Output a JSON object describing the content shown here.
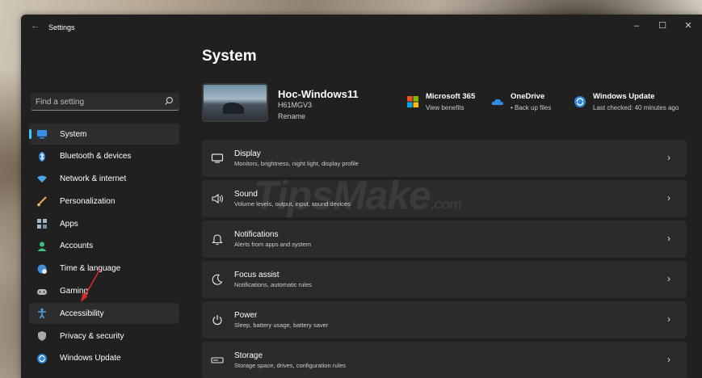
{
  "window": {
    "title": "Settings",
    "back_icon": "back-arrow-icon",
    "controls": {
      "minimize": "–",
      "maximize": "☐",
      "close": "✕"
    }
  },
  "page": {
    "title": "System"
  },
  "search": {
    "placeholder": "Find a setting",
    "icon": "search-icon"
  },
  "sidebar": {
    "items": [
      {
        "label": "System",
        "icon": "system-icon",
        "active": true
      },
      {
        "label": "Bluetooth & devices",
        "icon": "bluetooth-icon"
      },
      {
        "label": "Network & internet",
        "icon": "network-icon"
      },
      {
        "label": "Personalization",
        "icon": "brush-icon"
      },
      {
        "label": "Apps",
        "icon": "apps-icon"
      },
      {
        "label": "Accounts",
        "icon": "accounts-icon"
      },
      {
        "label": "Time & language",
        "icon": "globe-clock-icon"
      },
      {
        "label": "Gaming",
        "icon": "gamepad-icon"
      },
      {
        "label": "Accessibility",
        "icon": "accessibility-icon",
        "hover": true
      },
      {
        "label": "Privacy & security",
        "icon": "shield-icon"
      },
      {
        "label": "Windows Update",
        "icon": "update-icon"
      }
    ]
  },
  "device": {
    "name": "Hoc-Windows11",
    "model": "H61MGV3",
    "rename_label": "Rename"
  },
  "quick_links": {
    "microsoft365": {
      "title": "Microsoft 365",
      "subtitle": "View benefits"
    },
    "onedrive": {
      "title": "OneDrive",
      "subtitle": "• Back up files"
    },
    "windows_update": {
      "title": "Windows Update",
      "subtitle": "Last checked: 40 minutes ago"
    }
  },
  "cards": [
    {
      "title": "Display",
      "subtitle": "Monitors, brightness, night light, display profile",
      "icon": "monitor-icon"
    },
    {
      "title": "Sound",
      "subtitle": "Volume levels, output, input, sound devices",
      "icon": "speaker-icon"
    },
    {
      "title": "Notifications",
      "subtitle": "Alerts from apps and system",
      "icon": "bell-icon"
    },
    {
      "title": "Focus assist",
      "subtitle": "Notifications, automatic rules",
      "icon": "moon-icon"
    },
    {
      "title": "Power",
      "subtitle": "Sleep, battery usage, battery saver",
      "icon": "power-icon"
    },
    {
      "title": "Storage",
      "subtitle": "Storage space, drives, configuration rules",
      "icon": "storage-icon"
    }
  ],
  "watermark": {
    "main": "TipsMake",
    "suffix": ".com"
  },
  "colors": {
    "accent": "#4cc2ff",
    "window_bg": "#202020",
    "card_bg": "#2b2b2b",
    "arrow": "#e0262a"
  }
}
